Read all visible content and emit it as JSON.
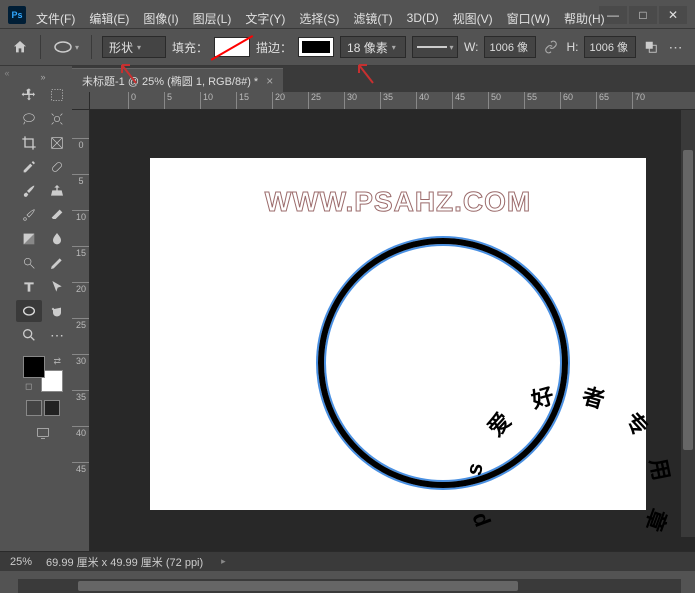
{
  "window": {
    "minimize": "—",
    "maximize": "□",
    "close": "✕"
  },
  "menubar": {
    "items": [
      {
        "label": "文件(F)"
      },
      {
        "label": "编辑(E)"
      },
      {
        "label": "图像(I)"
      },
      {
        "label": "图层(L)"
      },
      {
        "label": "文字(Y)"
      },
      {
        "label": "选择(S)"
      },
      {
        "label": "滤镜(T)"
      },
      {
        "label": "3D(D)"
      },
      {
        "label": "视图(V)"
      },
      {
        "label": "窗口(W)"
      },
      {
        "label": "帮助(H)"
      }
    ]
  },
  "optionsbar": {
    "mode_label": "形状",
    "fill_label": "填充：",
    "stroke_label": "描边：",
    "stroke_width": "18 像素",
    "w_label": "W:",
    "w_value": "1006 像",
    "h_label": "H:",
    "h_value": "1006 像"
  },
  "doctab": {
    "title": "未标题-1 @ 25% (椭圆 1, RGB/8#) *"
  },
  "ruler_h_ticks": [
    "0",
    "5",
    "10",
    "15",
    "20",
    "25",
    "30",
    "35",
    "40",
    "45",
    "50",
    "55",
    "60",
    "65",
    "70"
  ],
  "ruler_v_ticks": [
    "0",
    "5",
    "10",
    "15",
    "20",
    "25",
    "30",
    "35",
    "40",
    "45"
  ],
  "canvas": {
    "watermark": "WWW.PSAHZ.COM",
    "arc_chars": [
      "p",
      "s",
      "爱",
      "好",
      "者",
      "专",
      "用",
      "章"
    ]
  },
  "statusbar": {
    "zoom": "25%",
    "info": "69.99 厘米 x 49.99 厘米 (72 ppi)"
  }
}
